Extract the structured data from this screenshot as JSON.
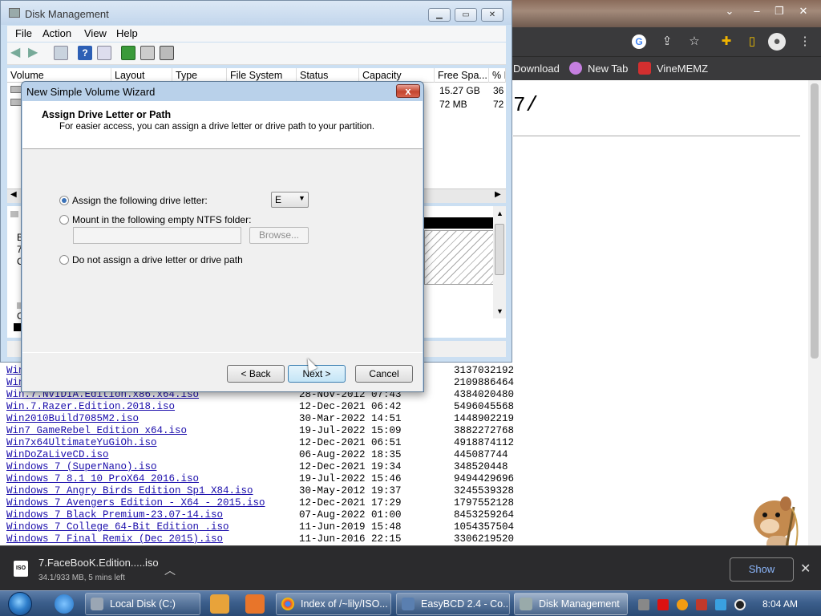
{
  "browser": {
    "bookmarks": [
      {
        "label": "Download",
        "color": "#ffffff"
      },
      {
        "label": "New Tab",
        "color": "#c57fe0"
      },
      {
        "label": "VineMEMZ",
        "color": "#d32f2f"
      }
    ],
    "page_heading": "7/",
    "files": [
      {
        "name": "Win",
        "date": "",
        "size": "3137032192"
      },
      {
        "name": "Win",
        "date": "",
        "size": "2109886464"
      },
      {
        "name": "Win.7.NVIDIA.Edition.x86.x64.iso",
        "date": "28-Nov-2012 07:43",
        "size": "4384020480"
      },
      {
        "name": "Win.7.Razer.Edition.2018.iso",
        "date": "12-Dec-2021 06:42",
        "size": "5496045568"
      },
      {
        "name": "Win2010Build7085M2.iso",
        "date": "30-Mar-2022 14:51",
        "size": "1448902219"
      },
      {
        "name": "Win7_GameRebel_Edition_x64.iso",
        "date": "19-Jul-2022 15:09",
        "size": "3882272768"
      },
      {
        "name": "Win7x64UltimateYuGiOh.iso",
        "date": "12-Dec-2021 06:51",
        "size": "4918874112"
      },
      {
        "name": "WinDoZaLiveCD.iso",
        "date": "06-Aug-2022 18:35",
        "size": "445087744"
      },
      {
        "name": "Windows 7 (SuperNano).iso",
        "date": "12-Dec-2021 19:34",
        "size": "348520448"
      },
      {
        "name": "Windows 7 8.1 10  ProX64 2016.iso",
        "date": "19-Jul-2022 15:46",
        "size": "9494429696"
      },
      {
        "name": "Windows 7 Angry Birds Edition Sp1 X84.iso",
        "date": "30-May-2012 19:37",
        "size": "3245539328"
      },
      {
        "name": "Windows 7 Avengers Edition - X64 - 2015.iso",
        "date": "12-Dec-2021 17:29",
        "size": "1797552128"
      },
      {
        "name": "Windows 7 Black Premium-23.07-14.iso",
        "date": "07-Aug-2022 01:00",
        "size": "8453259264"
      },
      {
        "name": "Windows 7 College 64-Bit Edition .iso",
        "date": "11-Jun-2019 15:48",
        "size": "1054357504"
      },
      {
        "name": "Windows 7 Final Remix (Dec 2015).iso",
        "date": "11-Jun-2016 22:15",
        "size": "3306219520"
      }
    ]
  },
  "download": {
    "filename": "7.FaceBooK.Edition.....iso",
    "status": "34.1/933 MB, 5 mins left",
    "show_all": "Show"
  },
  "disk_mgmt": {
    "title": "Disk Management",
    "menu": [
      "File",
      "Action",
      "View",
      "Help"
    ],
    "columns": [
      "Volume",
      "Layout",
      "Type",
      "File System",
      "Status",
      "Capacity",
      "Free Spa...",
      "% F"
    ],
    "rows": [
      {
        "free": "15.27 GB",
        "pct": "36"
      },
      {
        "free": "72 MB",
        "pct": "72"
      }
    ],
    "graph_labels": [
      "B",
      "7.",
      "O",
      "C"
    ]
  },
  "wizard": {
    "title": "New Simple Volume Wizard",
    "heading": "Assign Drive Letter or Path",
    "subheading": "For easier access, you can assign a drive letter or drive path to your partition.",
    "option_letter": "Assign the following drive letter:",
    "option_folder": "Mount in the following empty NTFS folder:",
    "option_none": "Do not assign a drive letter or drive path",
    "drive_letter": "E",
    "browse": "Browse...",
    "back": "< Back",
    "next": "Next >",
    "cancel": "Cancel",
    "close": "x"
  },
  "taskbar": {
    "buttons": [
      "Local Disk (C:)",
      "Index of /~lily/ISO...",
      "EasyBCD 2.4 - Co...",
      "Disk Management"
    ],
    "clock": "8:04 AM"
  },
  "colors": {
    "link": "#1a0dab",
    "taskbar": "#3c5f8c",
    "wizard_frame": "#b9d1ea",
    "radio_dot": "#3b72b8"
  }
}
